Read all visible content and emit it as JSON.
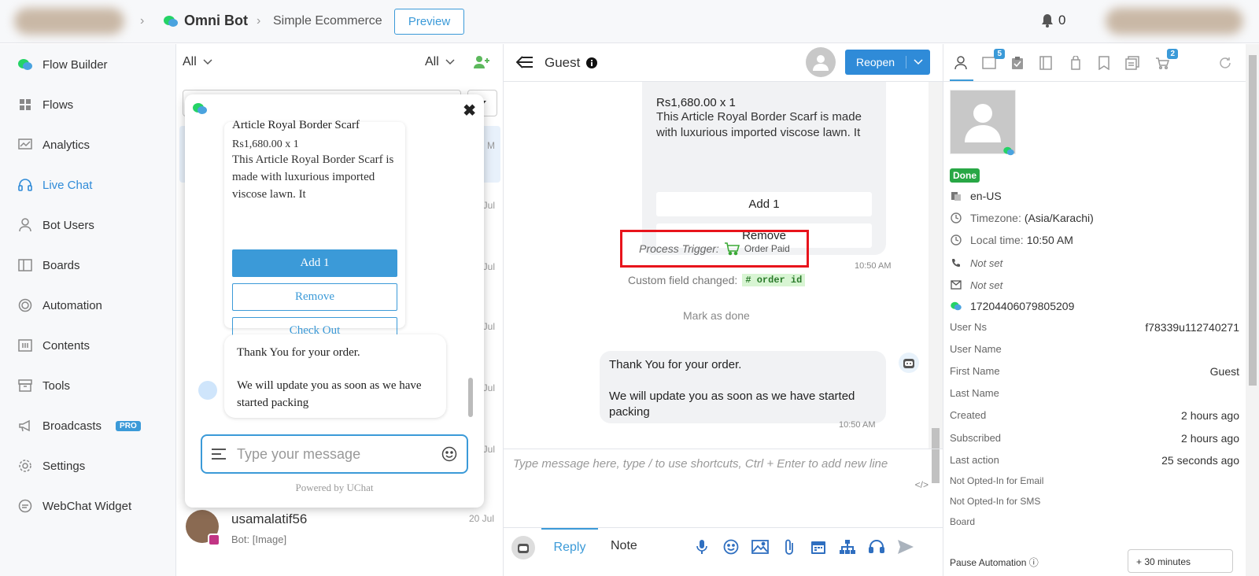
{
  "topbar": {
    "brand": "Omni Bot",
    "breadcrumb": "Simple Ecommerce",
    "preview_label": "Preview",
    "notification_count": "0"
  },
  "sidebar": {
    "items": [
      {
        "label": "Flow Builder",
        "icon": "chat-bubbles-icon"
      },
      {
        "label": "Flows",
        "icon": "grid-icon"
      },
      {
        "label": "Analytics",
        "icon": "chart-icon"
      },
      {
        "label": "Live Chat",
        "icon": "headset-icon"
      },
      {
        "label": "Bot Users",
        "icon": "user-icon"
      },
      {
        "label": "Boards",
        "icon": "board-icon"
      },
      {
        "label": "Automation",
        "icon": "automation-icon"
      },
      {
        "label": "Contents",
        "icon": "contents-icon"
      },
      {
        "label": "Tools",
        "icon": "tools-icon"
      },
      {
        "label": "Broadcasts",
        "icon": "megaphone-icon",
        "badge": "PRO"
      },
      {
        "label": "Settings",
        "icon": "gear-icon"
      },
      {
        "label": "WebChat Widget",
        "icon": "webchat-icon"
      }
    ]
  },
  "list": {
    "filter_left": "All",
    "filter_right": "All",
    "row_dates": [
      "M",
      "Jul",
      "Jul",
      "Jul",
      "Jul",
      "Jul"
    ],
    "contact": {
      "name": "usamalatif56",
      "preview": "Bot: [Image]",
      "date": "20 Jul"
    }
  },
  "widget": {
    "card": {
      "title": "Article Royal Border Scarf",
      "price": "Rs1,680.00 x 1",
      "description": "This Article Royal Border Scarf is made with luxurious imported viscose lawn. It",
      "buttons": [
        "Add 1",
        "Remove",
        "Check Out"
      ]
    },
    "message_line1": "Thank You for your order.",
    "message_line2": "We will update you as soon as we have started packing",
    "input_placeholder": "Type your message",
    "powered_by": "Powered by UChat"
  },
  "chat": {
    "header_title": "Guest",
    "reopen_label": "Reopen",
    "card": {
      "price": "Rs1,680.00 x 1",
      "description": "This Article Royal Border Scarf is made with luxurious imported viscose lawn. It",
      "buttons": [
        "Add 1",
        "Remove"
      ],
      "time": "10:50 AM"
    },
    "trigger": {
      "label": "Process Trigger:",
      "name": "Order Paid"
    },
    "custom_field": {
      "label": "Custom field changed:",
      "tag": "order id"
    },
    "mark_done": "Mark as done",
    "message": {
      "line1": "Thank You for your order.",
      "line2": "We will update you as soon as we have started packing",
      "time": "10:50 AM"
    },
    "composer_placeholder": "Type message here, type / to use shortcuts, Ctrl + Enter to add new line",
    "code_symbol": "</>",
    "tabs": {
      "reply": "Reply",
      "note": "Note"
    }
  },
  "profile": {
    "tab_badges": {
      "tab2": "5",
      "tab8": "2"
    },
    "status": "Done",
    "locale": "en-US",
    "timezone_label": "Timezone:",
    "timezone_value": "(Asia/Karachi)",
    "localtime_label": "Local time:",
    "localtime_value": "10:50 AM",
    "phone": "Not set",
    "email": "Not set",
    "channel_id": "17204406079805209",
    "fields": [
      {
        "k": "User Ns",
        "v": "f78339u112740271"
      },
      {
        "k": "User Name",
        "v": ""
      },
      {
        "k": "First Name",
        "v": "Guest"
      },
      {
        "k": "Last Name",
        "v": ""
      },
      {
        "k": "Created",
        "v": "2 hours ago"
      },
      {
        "k": "Subscribed",
        "v": "2 hours ago"
      },
      {
        "k": "Last action",
        "v": "25 seconds ago"
      },
      {
        "k": "Not Opted-In for Email",
        "v": ""
      },
      {
        "k": "Not Opted-In for SMS",
        "v": ""
      },
      {
        "k": "Board",
        "v": ""
      }
    ],
    "pause_automation": "Pause Automation ⓘ",
    "pause_value": "+ 30 minutes"
  },
  "colors": {
    "accent": "#3b9ad8",
    "highlight": "#e8141c",
    "done": "#28a745"
  }
}
